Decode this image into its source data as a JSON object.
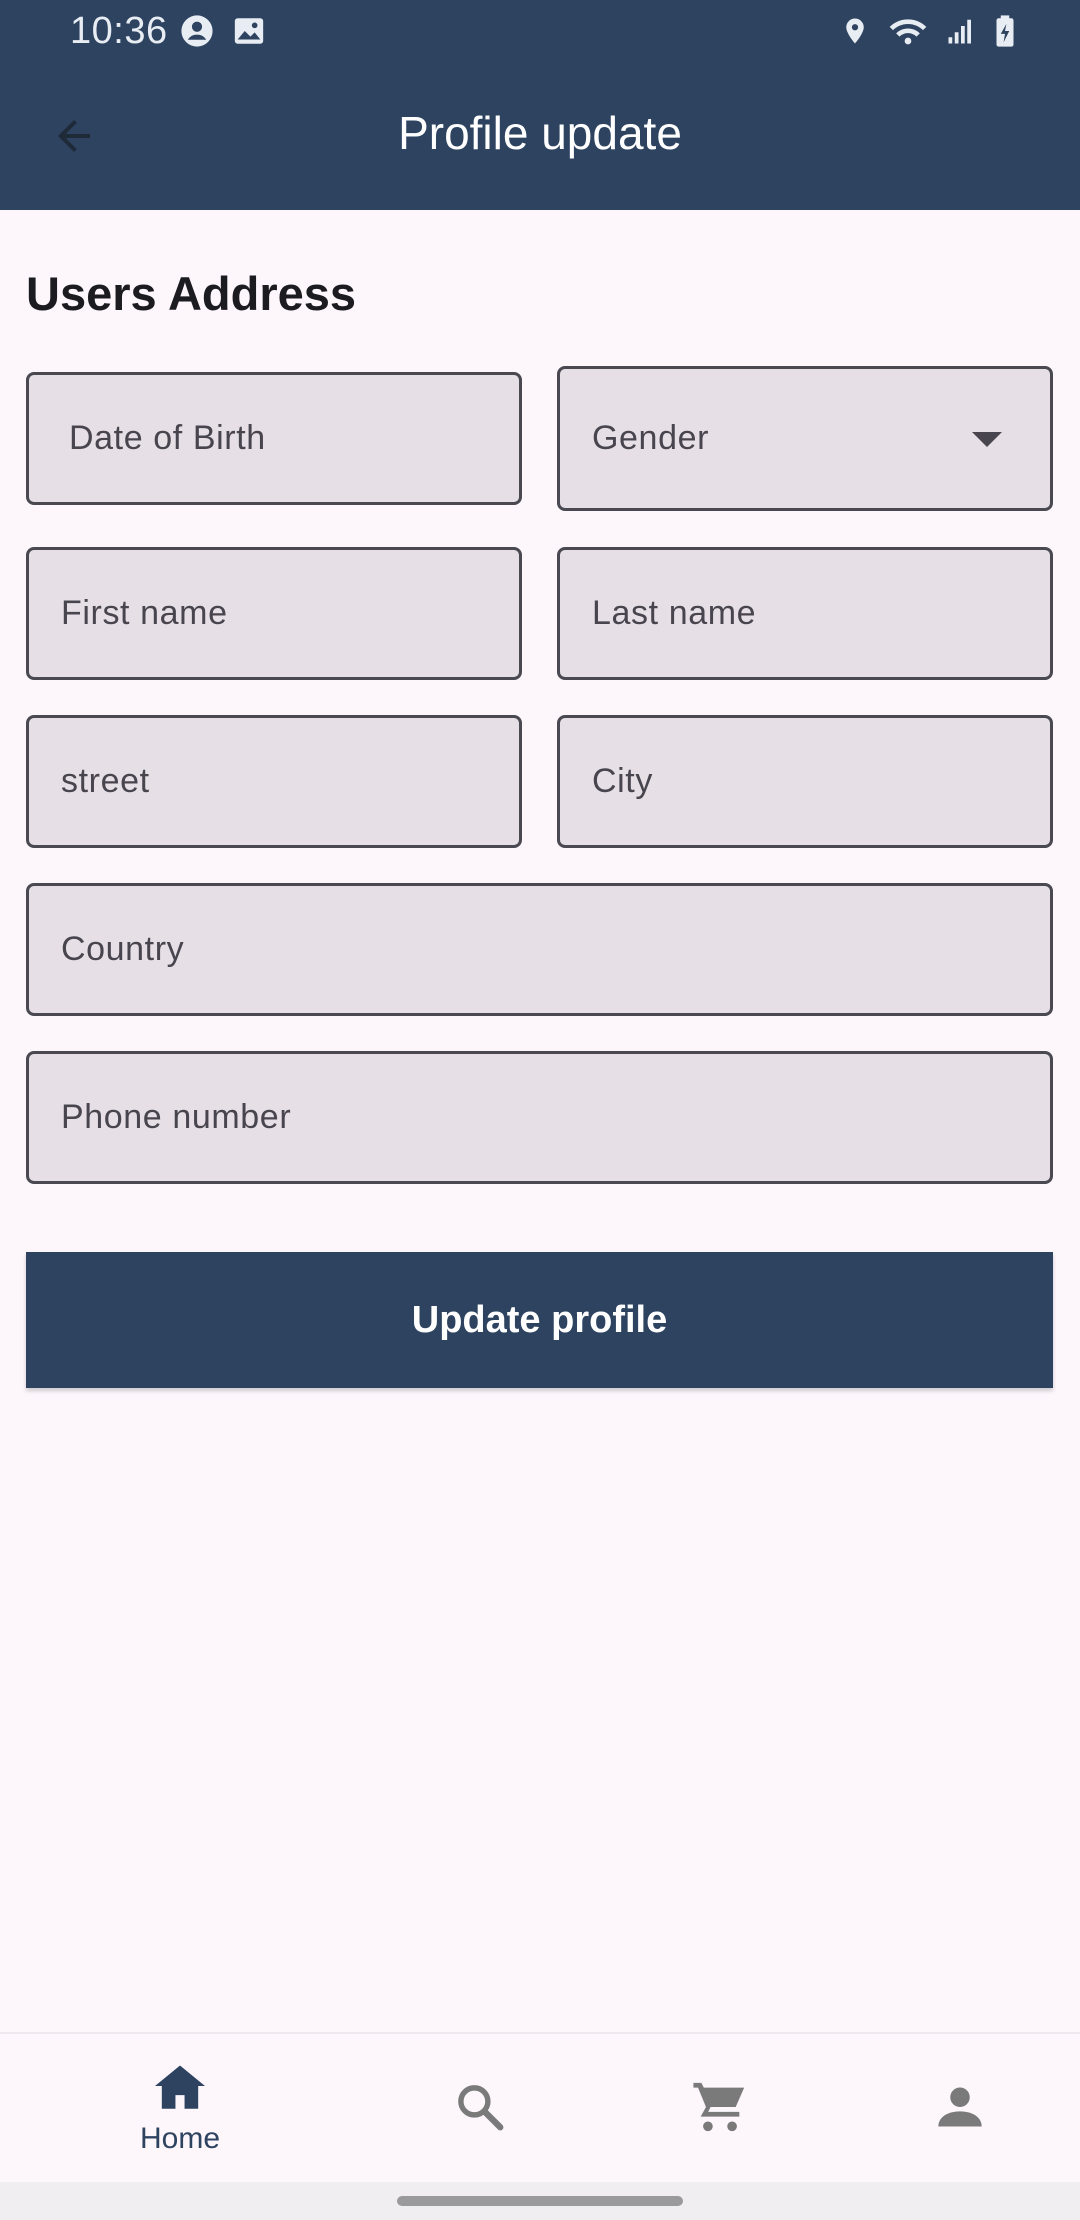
{
  "status_bar": {
    "time": "10:36"
  },
  "app_bar": {
    "title": "Profile update",
    "back_icon": "arrow-back-icon"
  },
  "form": {
    "section_title": "Users Address",
    "fields": {
      "date_of_birth": "Date of Birth",
      "gender": "Gender",
      "first_name": "First name",
      "last_name": "Last name",
      "street": "street",
      "city": "City",
      "country": "Country",
      "phone_number": "Phone number"
    },
    "submit_label": "Update profile"
  },
  "bottom_nav": {
    "items": [
      {
        "label": "Home",
        "icon": "home-icon",
        "selected": true
      },
      {
        "label": "",
        "icon": "search-icon",
        "selected": false
      },
      {
        "label": "",
        "icon": "cart-icon",
        "selected": false
      },
      {
        "label": "",
        "icon": "person-icon",
        "selected": false
      }
    ]
  },
  "colors": {
    "primary": "#2d4360",
    "background": "#fdf7fc",
    "field_fill": "#e6e0e6",
    "field_border": "#4a4850",
    "inactive_icon": "#7a7a7a"
  }
}
